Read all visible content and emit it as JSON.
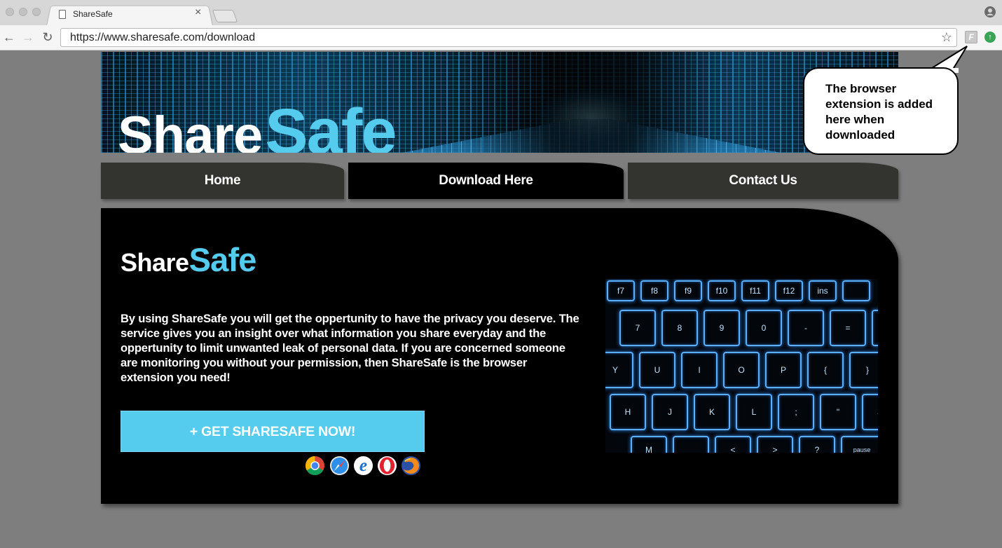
{
  "browser": {
    "tab_title": "ShareSafe",
    "tab_close": "×",
    "url": "https://www.sharesafe.com/download",
    "back": "←",
    "forward": "→",
    "reload": "↻",
    "bookmark_star": "☆",
    "extension_f": "F",
    "extension_green": "↑"
  },
  "site": {
    "logo_share": "Share",
    "logo_safe": "Safe",
    "nav": [
      {
        "label": "Home",
        "active": false
      },
      {
        "label": "Download Here",
        "active": true
      },
      {
        "label": "Contact Us",
        "active": false
      }
    ],
    "description": "By using ShareSafe you will get the oppertunity to have the privacy you deserve. The service gives you an insight over what information you share everyday and the oppertunity to limit unwanted leak of personal data. If you are concerned someone are monitoring you without your permission, then ShareSafe is the browser extension you need!",
    "cta_label": "+ GET SHARESAFE NOW!",
    "supported_browsers": [
      "chrome-icon",
      "safari-icon",
      "edge-icon",
      "opera-icon",
      "firefox-icon"
    ]
  },
  "callout": {
    "text": "The browser extension is added here when downloaded"
  },
  "keyboard": {
    "row1": [
      "f7",
      "f8",
      "f9",
      "f10",
      "f11",
      "f12",
      "ins"
    ],
    "row2": [
      "7",
      "8",
      "9",
      "0",
      "-",
      "="
    ],
    "row3": [
      "Y",
      "U",
      "I",
      "O",
      "P",
      "{",
      "}"
    ],
    "row4": [
      "H",
      "J",
      "K",
      "L",
      ";",
      "\"",
      "←"
    ],
    "row5": [
      "M",
      "<",
      ">",
      "?",
      "pause"
    ]
  },
  "colors": {
    "accent": "#55cbed",
    "page_bg": "#7e7e7e",
    "nav_bg": "#333330",
    "panel_bg": "#000000"
  }
}
